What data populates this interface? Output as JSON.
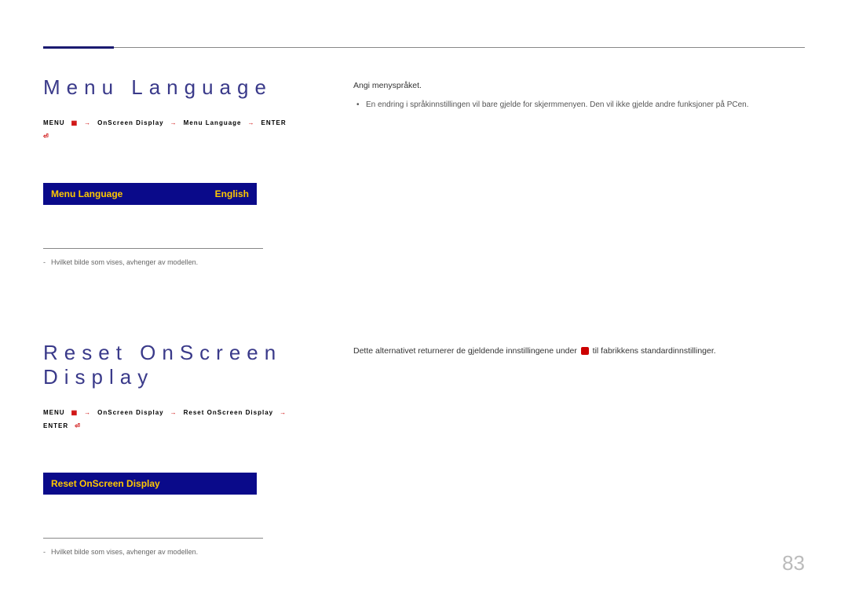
{
  "pageNumber": "83",
  "section1": {
    "title": "Menu Language",
    "breadcrumb": {
      "part1": "MENU",
      "part2": "OnScreen Display",
      "part3": "Menu Language",
      "part4": "ENTER"
    },
    "menuRow": {
      "label": "Menu Language",
      "value": "English"
    },
    "footnote": "Hvilket bilde som vises, avhenger av modellen.",
    "descMain": "Angi menyspråket.",
    "bullet": "En endring i språkinnstillingen vil bare gjelde for skjermmenyen. Den vil ikke gjelde andre funksjoner på PCen."
  },
  "section2": {
    "title": "Reset OnScreen Display",
    "breadcrumb": {
      "part1": "MENU",
      "part2": "OnScreen Display",
      "part3": "Reset OnScreen Display",
      "part4": "ENTER"
    },
    "menuRow": {
      "label": "Reset OnScreen Display"
    },
    "footnote": "Hvilket bilde som vises, avhenger av modellen.",
    "descPre": "Dette alternativet returnerer de gjeldende innstillingene under ",
    "descPost": " til fabrikkens standardinnstillinger."
  }
}
